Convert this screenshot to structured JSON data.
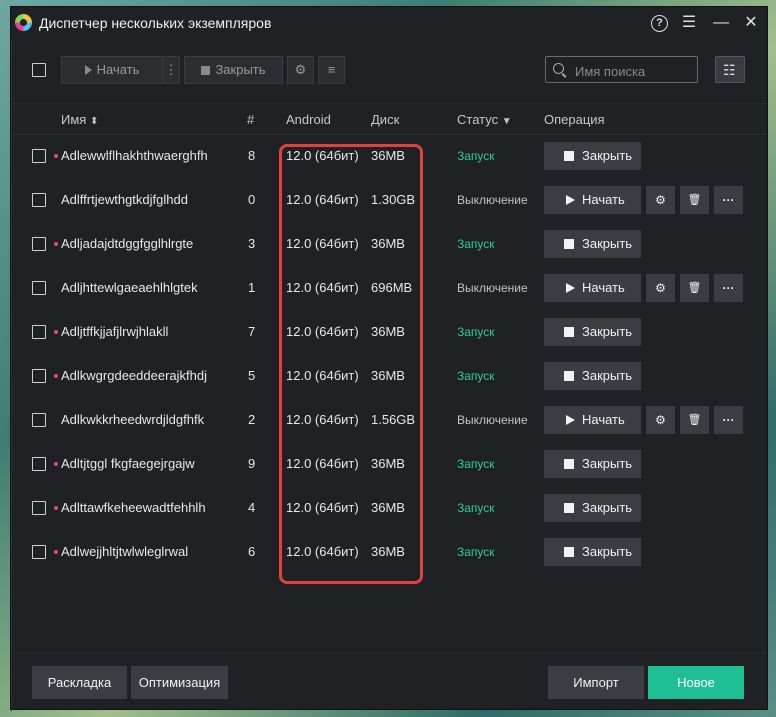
{
  "window": {
    "title": "Диспетчер нескольких экземпляров",
    "help_glyph": "?",
    "menu_glyph": "☰",
    "minimize_glyph": "—",
    "close_glyph": "✕"
  },
  "toolbar": {
    "start_label": "Начать",
    "more_glyph": "⋮",
    "close_label": "Закрыть",
    "settings_glyph": "⚙",
    "list_glyph": "≡",
    "search_placeholder": "Имя поиска",
    "view_glyph": "☷"
  },
  "table": {
    "headers": {
      "name": "Имя",
      "name_sort_glyph": "⬍",
      "num": "#",
      "android": "Android",
      "disk": "Диск",
      "status": "Статус",
      "status_filter_glyph": "▼",
      "operation": "Операция"
    },
    "rows": [
      {
        "name": "Adlewwlflhakhthwaerghfh",
        "num": "8",
        "android": "12.0 (64бит)",
        "disk": "36MB",
        "status": "Запуск",
        "running": true,
        "action": "Закрыть"
      },
      {
        "name": "Adlffrtjewthgtkdjfglhdd",
        "num": "0",
        "android": "12.0 (64бит)",
        "disk": "1.30GB",
        "status": "Выключение",
        "running": false,
        "action": "Начать"
      },
      {
        "name": "Adljadajdtdggfgglhlrgte",
        "num": "3",
        "android": "12.0 (64бит)",
        "disk": "36MB",
        "status": "Запуск",
        "running": true,
        "action": "Закрыть"
      },
      {
        "name": "Adljhttewlgaeaehlhlgtek",
        "num": "1",
        "android": "12.0 (64бит)",
        "disk": "696MB",
        "status": "Выключение",
        "running": false,
        "action": "Начать"
      },
      {
        "name": "Adljtffkjjafjlrwjhlakll",
        "num": "7",
        "android": "12.0 (64бит)",
        "disk": "36MB",
        "status": "Запуск",
        "running": true,
        "action": "Закрыть"
      },
      {
        "name": "Adlkwgrgdeeddeerajkfhdj",
        "num": "5",
        "android": "12.0 (64бит)",
        "disk": "36MB",
        "status": "Запуск",
        "running": true,
        "action": "Закрыть"
      },
      {
        "name": "Adlkwkkrheedwrdjldgfhfk",
        "num": "2",
        "android": "12.0 (64бит)",
        "disk": "1.56GB",
        "status": "Выключение",
        "running": false,
        "action": "Начать"
      },
      {
        "name": "Adltjtggl fkgfaegejrgajw",
        "num": "9",
        "android": "12.0 (64бит)",
        "disk": "36MB",
        "status": "Запуск",
        "running": true,
        "action": "Закрыть"
      },
      {
        "name": "Adlttawfkeheewadtfehhlh",
        "num": "4",
        "android": "12.0 (64бит)",
        "disk": "36MB",
        "status": "Запуск",
        "running": true,
        "action": "Закрыть"
      },
      {
        "name": "Adlwejjhltjtwlwleglrwal",
        "num": "6",
        "android": "12.0 (64бит)",
        "disk": "36MB",
        "status": "Запуск",
        "running": true,
        "action": "Закрыть"
      }
    ],
    "icons": {
      "settings": "⚙",
      "delete": "🗑",
      "more": "···"
    }
  },
  "footer": {
    "layout_label": "Раскладка",
    "optimize_label": "Оптимизация",
    "import_label": "Импорт",
    "new_label": "Новое"
  },
  "colors": {
    "running": "#2ecc9a",
    "accent": "#1fbf95",
    "highlight": "#e04040"
  }
}
